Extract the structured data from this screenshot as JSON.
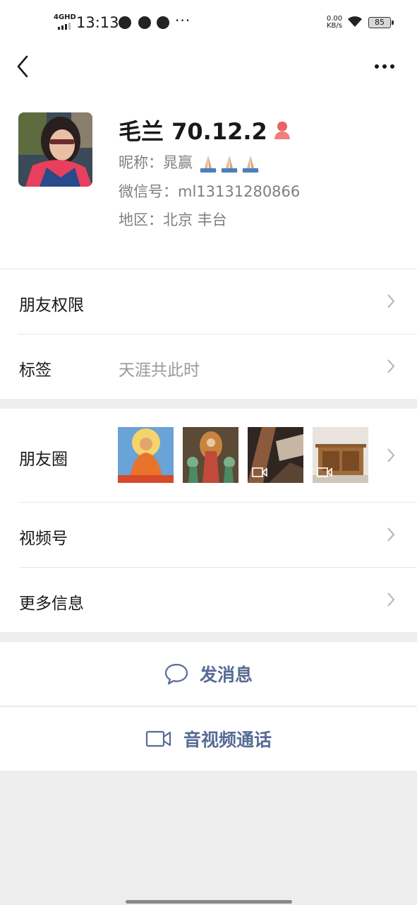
{
  "status_bar": {
    "network": "4GHD",
    "time": "13:13",
    "more": "···",
    "speed_value": "0.00",
    "speed_unit": "KB/s",
    "battery": "85"
  },
  "profile": {
    "name": "毛兰 70.12.2",
    "nickname": "昵称：晁赢",
    "wechat_id": "微信号：ml13131280866",
    "region": "地区：北京  丰台"
  },
  "rows": {
    "friend_permissions": "朋友权限",
    "tags_label": "标签",
    "tags_value": "天涯共此时",
    "moments": "朋友圈",
    "channels": "视频号",
    "more_info": "更多信息"
  },
  "actions": {
    "message": "发消息",
    "call": "音视频通话"
  },
  "colors": {
    "link": "#576b95",
    "background": "#ededed",
    "gender_female": "#f37e7d"
  }
}
